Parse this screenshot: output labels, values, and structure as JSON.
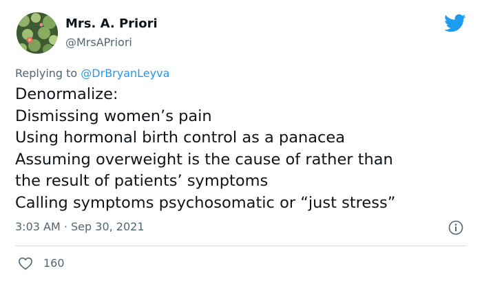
{
  "author": {
    "display_name": "Mrs. A. Priori",
    "handle": "@MrsAPriori",
    "avatar_icon": "water-lily-avatar"
  },
  "reply_context": {
    "prefix": "Replying to ",
    "mention": "@DrBryanLeyva"
  },
  "tweet": {
    "lines": [
      "Denormalize:",
      "Dismissing women’s pain",
      "Using hormonal birth control as a panacea",
      "Assuming overweight is the cause of rather than",
      "the result of patients’ symptoms",
      "Calling symptoms psychosomatic or “just stress”"
    ],
    "timestamp": "3:03 AM · Sep 30, 2021"
  },
  "engagement": {
    "like_count": "160"
  },
  "colors": {
    "accent": "#1d9bf0",
    "text_primary": "#0f1419",
    "text_secondary": "#536471",
    "divider": "#cfd9de"
  },
  "icons": {
    "brand": "twitter-bird-icon",
    "info": "info-icon",
    "like": "heart-icon"
  }
}
